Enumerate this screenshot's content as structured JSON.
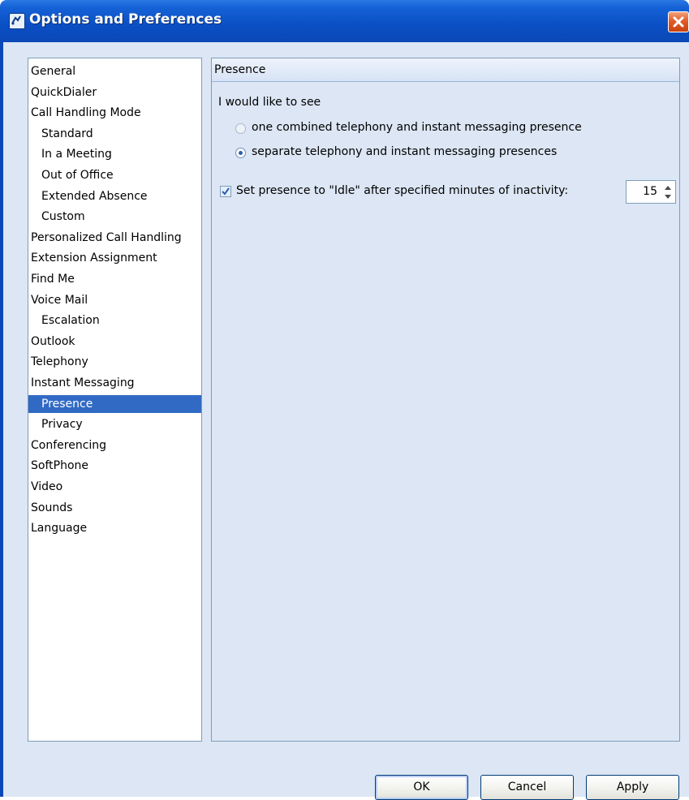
{
  "window": {
    "title": "Options and Preferences"
  },
  "nav": {
    "items": [
      {
        "label": "General",
        "indent": 0
      },
      {
        "label": "QuickDialer",
        "indent": 0
      },
      {
        "label": "Call Handling Mode",
        "indent": 0
      },
      {
        "label": "Standard",
        "indent": 1
      },
      {
        "label": "In a Meeting",
        "indent": 1
      },
      {
        "label": "Out of Office",
        "indent": 1
      },
      {
        "label": "Extended Absence",
        "indent": 1
      },
      {
        "label": "Custom",
        "indent": 1
      },
      {
        "label": "Personalized Call Handling",
        "indent": 0
      },
      {
        "label": "Extension Assignment",
        "indent": 0
      },
      {
        "label": "Find Me",
        "indent": 0
      },
      {
        "label": "Voice Mail",
        "indent": 0
      },
      {
        "label": "Escalation",
        "indent": 1
      },
      {
        "label": "Outlook",
        "indent": 0
      },
      {
        "label": "Telephony",
        "indent": 0
      },
      {
        "label": "Instant Messaging",
        "indent": 0
      },
      {
        "label": "Presence",
        "indent": 1,
        "selected": true
      },
      {
        "label": "Privacy",
        "indent": 1
      },
      {
        "label": "Conferencing",
        "indent": 0
      },
      {
        "label": "SoftPhone",
        "indent": 0
      },
      {
        "label": "Video",
        "indent": 0
      },
      {
        "label": "Sounds",
        "indent": 0
      },
      {
        "label": "Language",
        "indent": 0
      }
    ]
  },
  "panel": {
    "header": "Presence",
    "intro": "I would like to see",
    "radio_options": [
      {
        "label": "one combined telephony and instant messaging presence",
        "checked": false
      },
      {
        "label": "separate telephony and instant messaging presences",
        "checked": true
      }
    ],
    "idle_checkbox": {
      "label": "Set presence to \"Idle\" after specified minutes of inactivity:",
      "checked": true
    },
    "idle_minutes": "15"
  },
  "buttons": {
    "ok": "OK",
    "cancel": "Cancel",
    "apply": "Apply"
  },
  "colors": {
    "titlebar": "#0b4fc4",
    "selection": "#316ac5",
    "client_bg": "#dce6f4"
  }
}
